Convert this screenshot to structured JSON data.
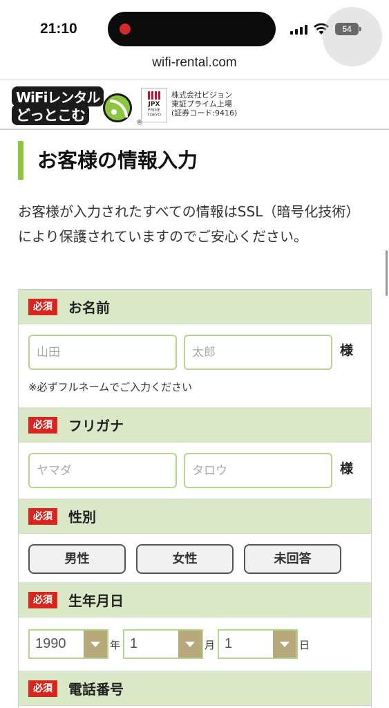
{
  "status": {
    "time": "21:10",
    "battery": "54"
  },
  "browser": {
    "url": "wifi-rental.com"
  },
  "header": {
    "logo_line1": "WiFiレンタル",
    "logo_line2": "どっとこむ",
    "logo_reg": "®",
    "jpx_label": "JPX",
    "jpx_sub": "PRIME TOKYO",
    "company_line1": "株式会社ビジョン",
    "company_line2": "東証プライム上場",
    "company_line3": "(証券コード:9416)"
  },
  "page": {
    "title": "お客様の情報入力",
    "intro": "お客様が入力されたすべての情報はSSL（暗号化技術）により保護されていますのでご安心ください。"
  },
  "form": {
    "required_label": "必須",
    "name": {
      "label": "お名前",
      "last_placeholder": "山田",
      "first_placeholder": "太郎",
      "suffix": "様",
      "note": "※必ずフルネームでご入力ください"
    },
    "furigana": {
      "label": "フリガナ",
      "last_placeholder": "ヤマダ",
      "first_placeholder": "タロウ",
      "suffix": "様"
    },
    "gender": {
      "label": "性別",
      "options": [
        "男性",
        "女性",
        "未回答"
      ]
    },
    "birthday": {
      "label": "生年月日",
      "year": "1990",
      "year_unit": "年",
      "month": "1",
      "month_unit": "月",
      "day": "1",
      "day_unit": "日"
    },
    "phone": {
      "label": "電話番号"
    }
  },
  "colors": {
    "accent_green": "#8cc63f",
    "section_bg": "#dae8c7",
    "required_red": "#d9251d",
    "select_arrow": "#b7a97c"
  }
}
